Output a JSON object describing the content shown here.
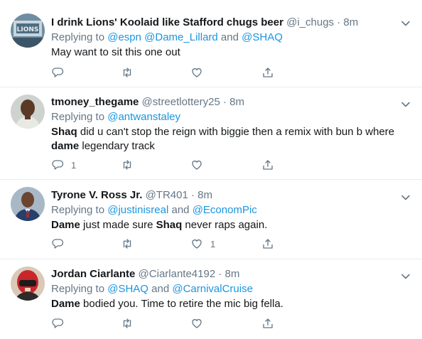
{
  "tweets": [
    {
      "name": "I drink Lions' Koolaid like Stafford chugs beer",
      "handle": "@i_chugs",
      "dot": "·",
      "time": "8m",
      "replying_prefix": "Replying to",
      "replying_to": [
        {
          "text": "@espn",
          "is_link": true
        },
        {
          "text": " ",
          "is_link": false
        },
        {
          "text": "@Dame_Lillard",
          "is_link": true
        },
        {
          "text": " and ",
          "is_link": false
        },
        {
          "text": "@SHAQ",
          "is_link": true
        }
      ],
      "text_parts": [
        {
          "text": "May want to sit this one out",
          "bold": false
        }
      ],
      "reply_count": "",
      "retweet_count": "",
      "like_count": ""
    },
    {
      "name": "tmoney_thegame",
      "handle": "@streetlottery25",
      "dot": "·",
      "time": "8m",
      "replying_prefix": "Replying to",
      "replying_to": [
        {
          "text": "@antwanstaley",
          "is_link": true
        }
      ],
      "text_parts": [
        {
          "text": "Shaq",
          "bold": true
        },
        {
          "text": " did u can't stop the reign with biggie then a remix with bun b where ",
          "bold": false
        },
        {
          "text": "dame",
          "bold": true
        },
        {
          "text": " legendary track",
          "bold": false
        }
      ],
      "reply_count": "1",
      "retweet_count": "",
      "like_count": ""
    },
    {
      "name": "Tyrone V. Ross Jr.",
      "handle": "@TR401",
      "dot": "·",
      "time": "8m",
      "replying_prefix": "Replying to",
      "replying_to": [
        {
          "text": "@justinisreal",
          "is_link": true
        },
        {
          "text": " and ",
          "is_link": false
        },
        {
          "text": "@EconomPic",
          "is_link": true
        }
      ],
      "text_parts": [
        {
          "text": "Dame",
          "bold": true
        },
        {
          "text": " just made sure ",
          "bold": false
        },
        {
          "text": "Shaq",
          "bold": true
        },
        {
          "text": " never raps again.",
          "bold": false
        }
      ],
      "reply_count": "",
      "retweet_count": "",
      "like_count": "1"
    },
    {
      "name": "Jordan Ciarlante",
      "handle": "@Ciarlante4192",
      "dot": "·",
      "time": "8m",
      "replying_prefix": "Replying to",
      "replying_to": [
        {
          "text": "@SHAQ",
          "is_link": true
        },
        {
          "text": " and ",
          "is_link": false
        },
        {
          "text": "@CarnivalCruise",
          "is_link": true
        }
      ],
      "text_parts": [
        {
          "text": "Dame",
          "bold": true
        },
        {
          "text": " bodied you. Time to retire the mic big fella.",
          "bold": false
        }
      ],
      "reply_count": "",
      "retweet_count": "",
      "like_count": ""
    }
  ],
  "icons": {
    "reply": "reply-icon",
    "retweet": "retweet-icon",
    "like": "heart-icon",
    "share": "share-icon",
    "caret": "chevron-down-icon"
  },
  "colors": {
    "link": "#1b95e0",
    "muted": "#657786",
    "text": "#14171a",
    "divider": "#e6ecf0"
  }
}
